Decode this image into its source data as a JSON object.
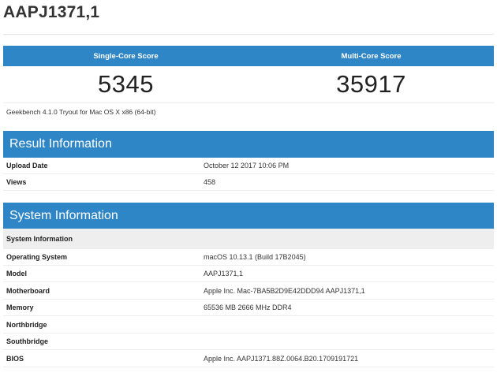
{
  "title": "AAPJ1371,1",
  "scores": {
    "single_label": "Single-Core Score",
    "multi_label": "Multi-Core Score",
    "single_value": "5345",
    "multi_value": "35917"
  },
  "version_text": "Geekbench 4.1.0 Tryout for Mac OS X x86 (64-bit)",
  "result_info": {
    "title": "Result Information",
    "rows": [
      {
        "label": "Upload Date",
        "value": "October 12 2017 10:06 PM"
      },
      {
        "label": "Views",
        "value": "458"
      }
    ]
  },
  "system_info": {
    "title": "System Information",
    "subheader": "System Information",
    "rows": [
      {
        "label": "Operating System",
        "value": "macOS 10.13.1 (Build 17B2045)"
      },
      {
        "label": "Model",
        "value": "AAPJ1371,1"
      },
      {
        "label": "Motherboard",
        "value": "Apple Inc. Mac-7BA5B2D9E42DDD94 AAPJ1371,1"
      },
      {
        "label": "Memory",
        "value": "65536 MB 2666 MHz DDR4"
      },
      {
        "label": "Northbridge",
        "value": ""
      },
      {
        "label": "Southbridge",
        "value": ""
      },
      {
        "label": "BIOS",
        "value": "Apple Inc. AAPJ1371.88Z.0064.B20.1709191721"
      }
    ]
  },
  "colors": {
    "accent": "#2f86c6",
    "header_text": "#ffffff",
    "subheader_bg": "#eeeeee"
  }
}
